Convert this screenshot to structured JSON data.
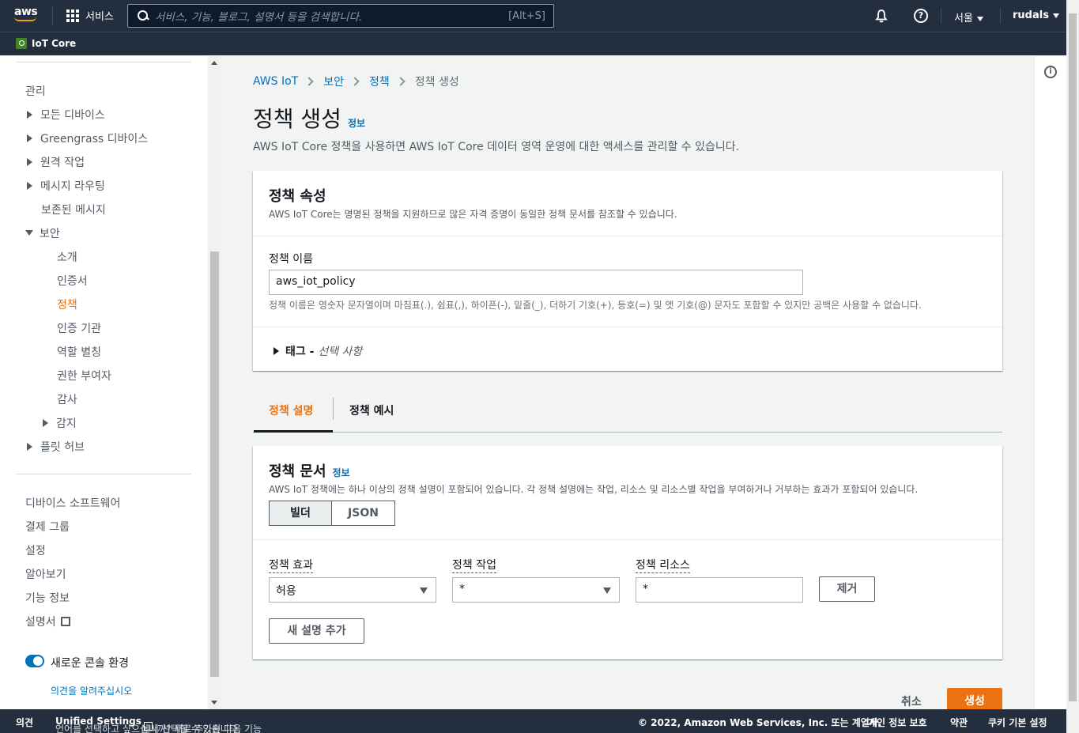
{
  "topnav": {
    "logo": "aws",
    "services_label": "서비스",
    "search_placeholder": "서비스, 기능, 블로그, 설명서 등을 검색합니다.",
    "search_shortcut": "[Alt+S]",
    "region": "서울",
    "user": "rudals"
  },
  "service_bar": {
    "service_name": "IoT Core"
  },
  "sidebar": {
    "section_head": "관리",
    "items": [
      {
        "label": "모든 디바이스"
      },
      {
        "label": "Greengrass 디바이스"
      },
      {
        "label": "원격 작업"
      },
      {
        "label": "메시지 라우팅"
      },
      {
        "label": "보존된 메시지"
      },
      {
        "label": "보안"
      },
      {
        "label": "소개"
      },
      {
        "label": "인증서"
      },
      {
        "label": "정책"
      },
      {
        "label": "인증 기관"
      },
      {
        "label": "역할 별칭"
      },
      {
        "label": "권한 부여자"
      },
      {
        "label": "감사"
      },
      {
        "label": "감지"
      },
      {
        "label": "플릿 허브"
      }
    ],
    "bottom_items": [
      {
        "label": "디바이스 소프트웨어"
      },
      {
        "label": "결제 그룹"
      },
      {
        "label": "설정"
      },
      {
        "label": "알아보기"
      },
      {
        "label": "기능 정보"
      },
      {
        "label": "설명서"
      }
    ],
    "toggle_label": "새로운 콘솔 환경",
    "feedback_link": "의견을 알려주십시오"
  },
  "breadcrumb": [
    "AWS IoT",
    "보안",
    "정책",
    "정책 생성"
  ],
  "page": {
    "title": "정책 생성",
    "info": "정보",
    "description": "AWS IoT Core 정책을 사용하면 AWS IoT Core 데이터 영역 운영에 대한 액세스를 관리할 수 있습니다."
  },
  "properties": {
    "title": "정책 속성",
    "subtitle": "AWS IoT Core는 명명된 정책을 지원하므로 많은 자격 증명이 동일한 정책 문서를 참조할 수 있습니다.",
    "name_label": "정책 이름",
    "name_value": "aws_iot_policy",
    "name_hint": "정책 이름은 영숫자 문자열이며 마침표(.), 쉼표(,), 하이픈(-), 밑줄(_), 더하기 기호(+), 등호(=) 및 앳 기호(@) 문자도 포함할 수 있지만 공백은 사용할 수 없습니다.",
    "tags_label": "태그 -",
    "tags_optional": "선택 사항"
  },
  "tabs": [
    "정책 설명",
    "정책 예시"
  ],
  "document": {
    "title": "정책 문서",
    "info": "정보",
    "subtitle": "AWS IoT 정책에는 하나 이상의 정책 설명이 포함되어 있습니다. 각 정책 설명에는 작업, 리소스 및 리소스별 작업을 부여하거나 거부하는 효과가 포함되어 있습니다.",
    "mode_builder": "빌더",
    "mode_json": "JSON",
    "effect_label": "정책 효과",
    "effect_value": "허용",
    "action_label": "정책 작업",
    "action_value": "*",
    "resource_label": "정책 리소스",
    "resource_value": "*",
    "remove_button": "제거",
    "add_button": "새 설명 추가"
  },
  "actions": {
    "cancel": "취소",
    "create": "생성"
  },
  "footer": {
    "feedback": "의견",
    "language_prompt": "언어를 선택하고 싶으십니까? 새로 추가된 다음 기능",
    "unified_settings": "Unified Settings",
    "language_prompt_end": "에서 선택할 수 있습니다.",
    "copyright": "© 2022, Amazon Web Services, Inc. 또는 계열사.",
    "privacy": "개인 정보 보호",
    "terms": "약관",
    "cookies": "쿠키 기본 설정"
  }
}
